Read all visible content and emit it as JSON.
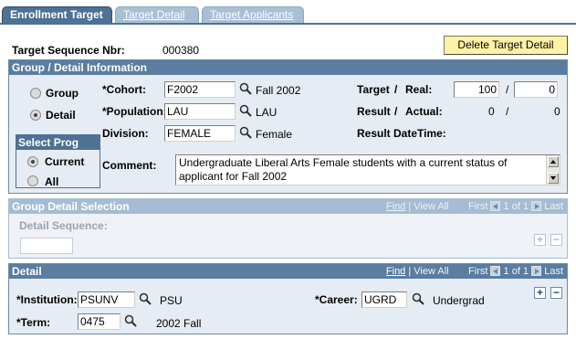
{
  "tabs": [
    {
      "label": "Enrollment Target",
      "active": true
    },
    {
      "label": "Target Detail",
      "active": false
    },
    {
      "label": "Target Applicants",
      "active": false
    }
  ],
  "target_seq": {
    "label": "Target Sequence Nbr:",
    "value": "000380"
  },
  "delete_button": "Delete Target Detail",
  "group_section": {
    "title": "Group / Detail Information",
    "radio_group": "Group",
    "radio_detail": "Detail",
    "selected": "Detail",
    "select_prog": {
      "title": "Select Prog",
      "current": "Current",
      "all": "All",
      "selected": "Current"
    },
    "cohort": {
      "label": "*Cohort:",
      "value": "F2002",
      "desc": "Fall 2002"
    },
    "population": {
      "label": "*Population:",
      "value": "LAU",
      "desc": "LAU"
    },
    "division": {
      "label": "Division:",
      "value": "FEMALE",
      "desc": "Female"
    },
    "comment": {
      "label": "Comment:",
      "value": "Undergraduate Liberal Arts Female students with a current status of applicant for Fall 2002"
    },
    "target": {
      "label": "Target",
      "sep": "/",
      "real_label": "Real:",
      "value1": "100",
      "value2": "0"
    },
    "result": {
      "label": "Result",
      "sep": "/",
      "actual_label": "Actual:",
      "value1": "0",
      "value2": "0"
    },
    "result_datetime": {
      "label": "Result DateTime:"
    }
  },
  "group_detail_section": {
    "title": "Group Detail Selection",
    "nav": {
      "find": "Find",
      "view_all": "View All",
      "first": "First",
      "count": "1 of 1",
      "last": "Last",
      "bar": "|"
    },
    "detail_sequence_label": "Detail Sequence:",
    "detail_sequence_value": ""
  },
  "detail_section": {
    "title": "Detail",
    "nav": {
      "find": "Find",
      "view_all": "View All",
      "first": "First",
      "count": "1 of 1",
      "last": "Last",
      "bar": "|"
    },
    "institution": {
      "label": "*Institution:",
      "value": "PSUNV",
      "desc": "PSU"
    },
    "career": {
      "label": "*Career:",
      "value": "UGRD",
      "desc": "Undergrad"
    },
    "term": {
      "label": "*Term:",
      "value": "0475",
      "desc": "2002 Fall"
    }
  },
  "colors": {
    "tab_active": "#4f7193",
    "tab_inactive": "#a9bfd6",
    "section_header": "#5a7da0",
    "button": "#fff2a6"
  },
  "icons": {
    "lookup": "magnifier-icon",
    "add": "plus-icon",
    "delete": "minus-icon"
  }
}
